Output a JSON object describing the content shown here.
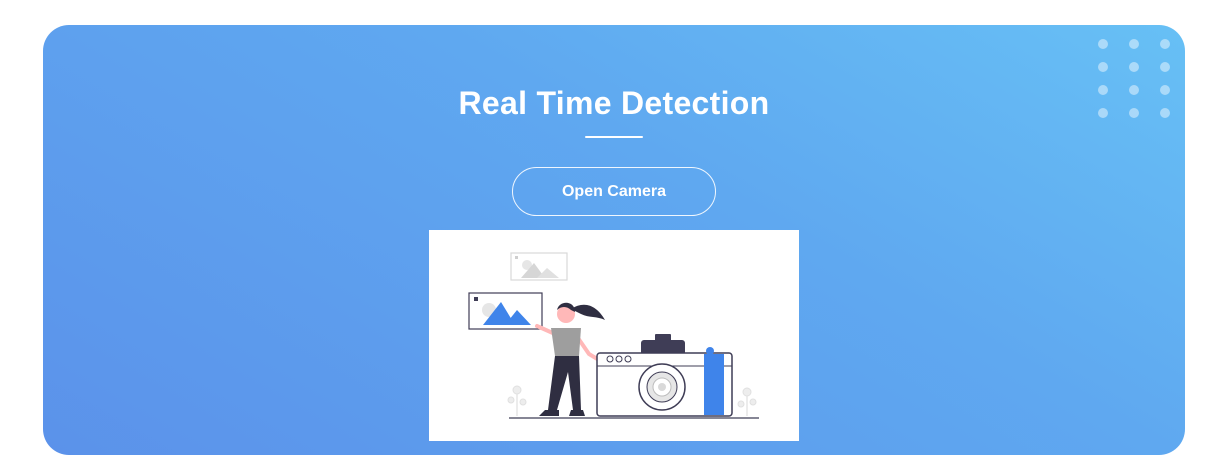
{
  "hero": {
    "title": "Real Time Detection",
    "button_label": "Open Camera",
    "illustration_icon": "woman-with-camera-illustration"
  },
  "colors": {
    "gradient_start": "#67c0f5",
    "gradient_end": "#5b92ea",
    "accent": "#3f84ea",
    "text": "#ffffff"
  }
}
